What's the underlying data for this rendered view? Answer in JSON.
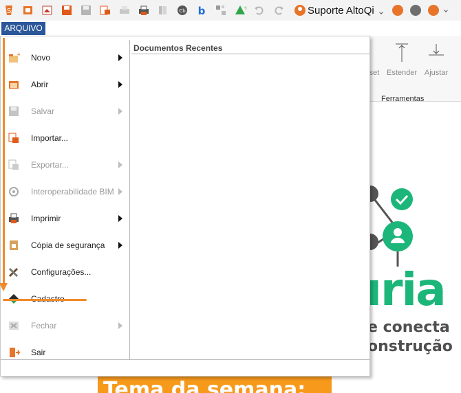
{
  "toolbar": {
    "icons": [
      "app-logo-icon",
      "new-file-icon",
      "open-pdf-icon",
      "save-icon",
      "save-disabled-icon",
      "export-icon",
      "print-preview-icon",
      "print-icon",
      "library-icon",
      "cb-icon",
      "b-icon",
      "grid-icon",
      "tree-icon",
      "undo-icon",
      "redo-icon"
    ],
    "user_name": "Suporte AltoQi"
  },
  "ribbon": {
    "buttons": [
      {
        "label": "set"
      },
      {
        "label": "Estender"
      },
      {
        "label": "Ajustar"
      }
    ],
    "group_label": "Ferramentas"
  },
  "background": {
    "brand": "uria",
    "line1": "e conecta",
    "line2": "onstrução",
    "banner": "Tema da semana:"
  },
  "file_tab": {
    "label": "ARQUIVO"
  },
  "menu": {
    "items": [
      {
        "label": "Novo",
        "enabled": true,
        "submenu": true,
        "icon": "new-icon"
      },
      {
        "label": "Abrir",
        "enabled": true,
        "submenu": true,
        "icon": "open-icon"
      },
      {
        "label": "Salvar",
        "enabled": false,
        "submenu": true,
        "icon": "save-icon"
      },
      {
        "label": "Importar...",
        "enabled": true,
        "submenu": false,
        "icon": "import-icon"
      },
      {
        "label": "Exportar...",
        "enabled": false,
        "submenu": true,
        "icon": "export-icon"
      },
      {
        "label": "Interoperabilidade BIM",
        "enabled": false,
        "submenu": true,
        "icon": "bim-icon"
      },
      {
        "label": "Imprimir",
        "enabled": true,
        "submenu": true,
        "icon": "print-icon"
      },
      {
        "label": "Cópia de segurança",
        "enabled": true,
        "submenu": true,
        "icon": "backup-icon"
      },
      {
        "label": "Configurações...",
        "enabled": true,
        "submenu": false,
        "icon": "tools-icon"
      },
      {
        "label": "Cadastro",
        "enabled": true,
        "submenu": false,
        "icon": "register-icon"
      },
      {
        "label": "Fechar",
        "enabled": false,
        "submenu": true,
        "icon": "close-icon"
      },
      {
        "label": "Sair",
        "enabled": true,
        "submenu": false,
        "icon": "exit-icon"
      }
    ],
    "recent_documents_header": "Documentos Recentes"
  },
  "colors": {
    "accent": "#2b579a",
    "annotation": "#f08a2a",
    "brand_green": "#1db67a",
    "banner_orange": "#f79a1c"
  }
}
